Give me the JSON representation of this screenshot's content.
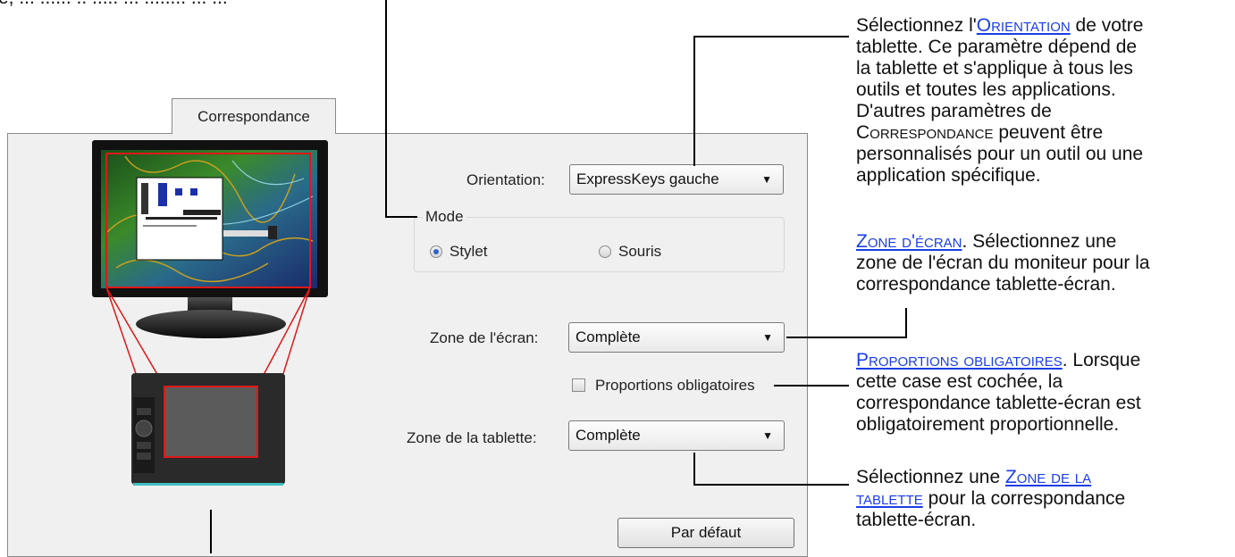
{
  "tab": {
    "label": "Correspondance"
  },
  "orientation": {
    "label": "Orientation:",
    "value": "ExpressKeys gauche"
  },
  "mode": {
    "group_label": "Mode",
    "stylet_label": "Stylet",
    "souris_label": "Souris",
    "selected": "Stylet"
  },
  "zone_ecran": {
    "label": "Zone de l'écran:",
    "value": "Complète"
  },
  "proportions": {
    "label": "Proportions obligatoires",
    "checked": false
  },
  "zone_tablette": {
    "label": "Zone de la tablette:",
    "value": "Complète"
  },
  "default_button": {
    "label": "Par défaut"
  },
  "annotations": {
    "top_clipped": "e, ... ...... .. ..... ... ........ ... ...",
    "orientation_note": {
      "pre": "Sélectionnez l'",
      "link": "Orientation",
      "post": " de votre tablette. Ce paramètre dépend de la tablette et s'applique à tous les outils et toutes les applications. D'autres paramètres de ",
      "smallcaps": "Correspondance",
      "tail": " peuvent être personnalisés pour un outil ou une application spécifique."
    },
    "zone_ecran_note": {
      "link": "Zone d'écran",
      "text": ". Sélectionnez une zone de l'écran du moniteur pour la correspondance tablette-écran."
    },
    "proportions_note": {
      "link": "Proportions obligatoires",
      "text": ". Lorsque cette case est cochée, la correspondance tablette-écran est obligatoirement proportionnelle."
    },
    "zone_tablette_note": {
      "pre": "Sélectionnez une ",
      "link": "Zone de la tablette",
      "post": " pour la correspondance tablette-écran."
    }
  },
  "icons": {
    "dropdown": "chevron-down-icon",
    "radio": "radio-icon",
    "checkbox": "checkbox-icon"
  },
  "colors": {
    "link": "#1a3ee6",
    "mapping_lines": "#e01818",
    "radio_dot": "#2a66c9"
  }
}
